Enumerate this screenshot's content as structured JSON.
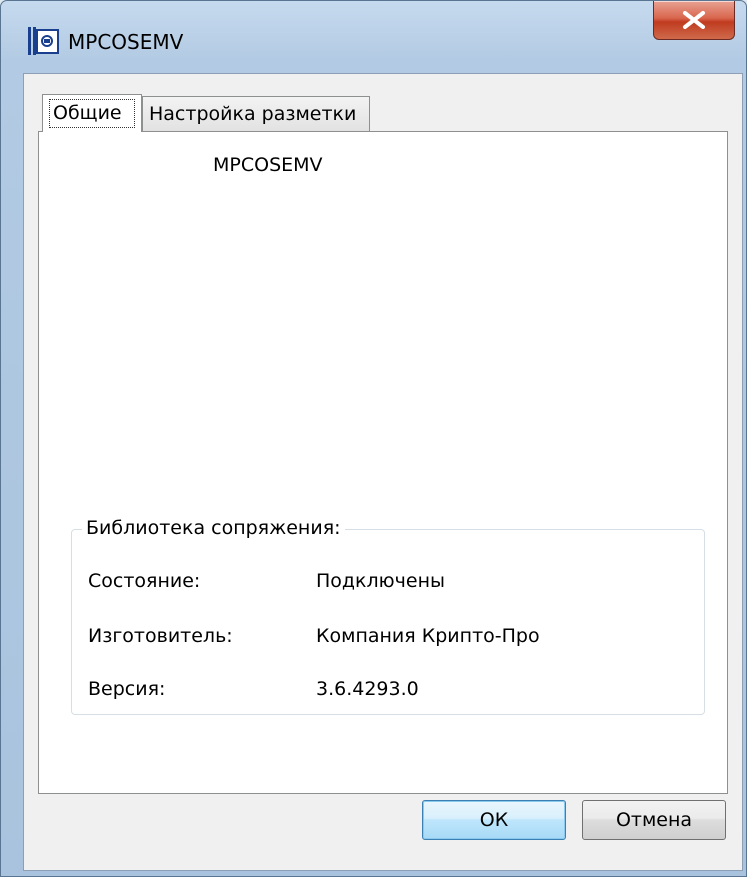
{
  "window": {
    "title": "MPCOSEMV",
    "close_symbol": "✕"
  },
  "tabs": [
    {
      "label": "Общие",
      "active": true
    },
    {
      "label": "Настройка разметки",
      "active": false
    }
  ],
  "general": {
    "device_name": "MPCOSEMV",
    "library": {
      "title": "Библиотека сопряжения:",
      "rows": [
        {
          "label": "Состояние:",
          "value": "Подключены"
        },
        {
          "label": "Изготовитель:",
          "value": "Компания Крипто-Про"
        },
        {
          "label": "Версия:",
          "value": "3.6.4293.0"
        }
      ]
    }
  },
  "buttons": {
    "ok": "ОК",
    "cancel": "Отмена"
  },
  "colors": {
    "title_bar": "#b9d1ea",
    "close_button": "#c9462c",
    "default_button": "#3c7fb1"
  }
}
